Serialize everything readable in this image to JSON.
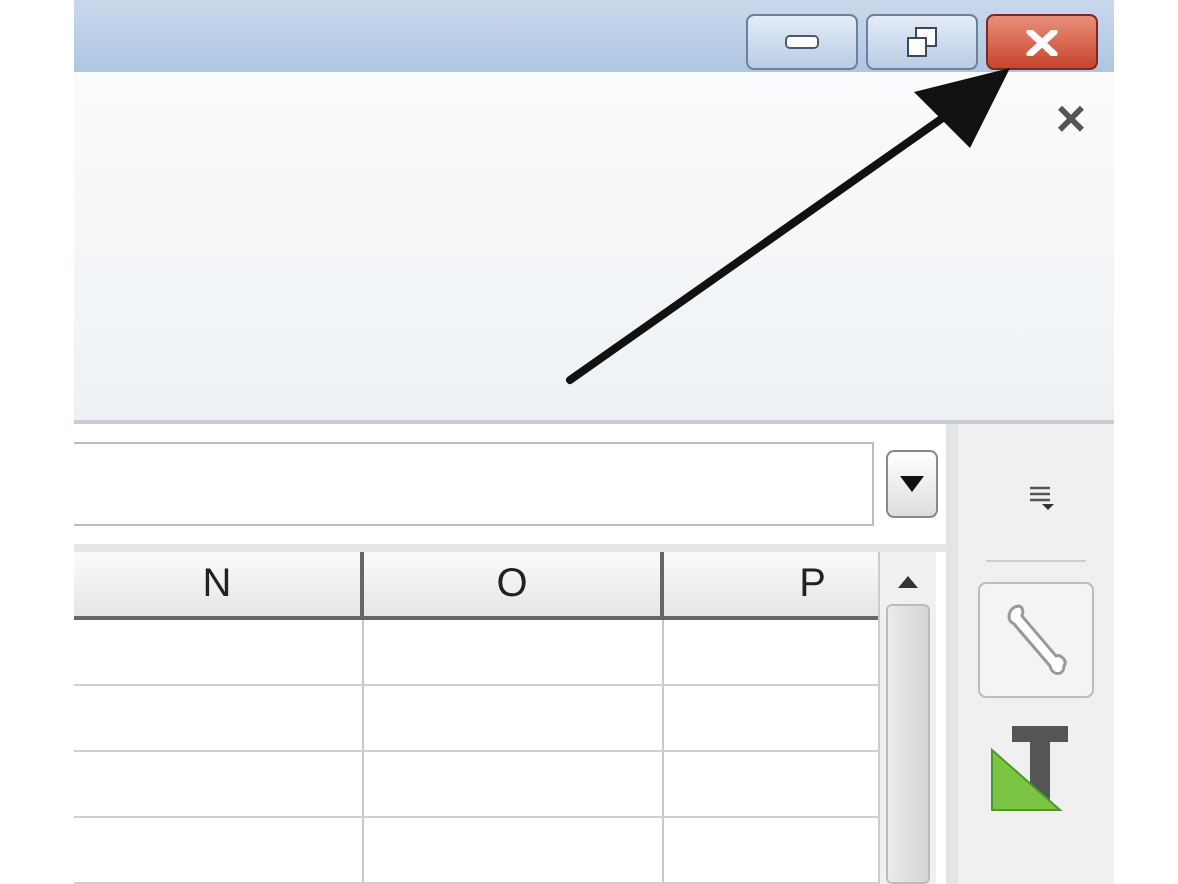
{
  "ribbon": {
    "close_glyph": "×"
  },
  "table": {
    "columns": [
      "N",
      "O",
      "P"
    ]
  }
}
